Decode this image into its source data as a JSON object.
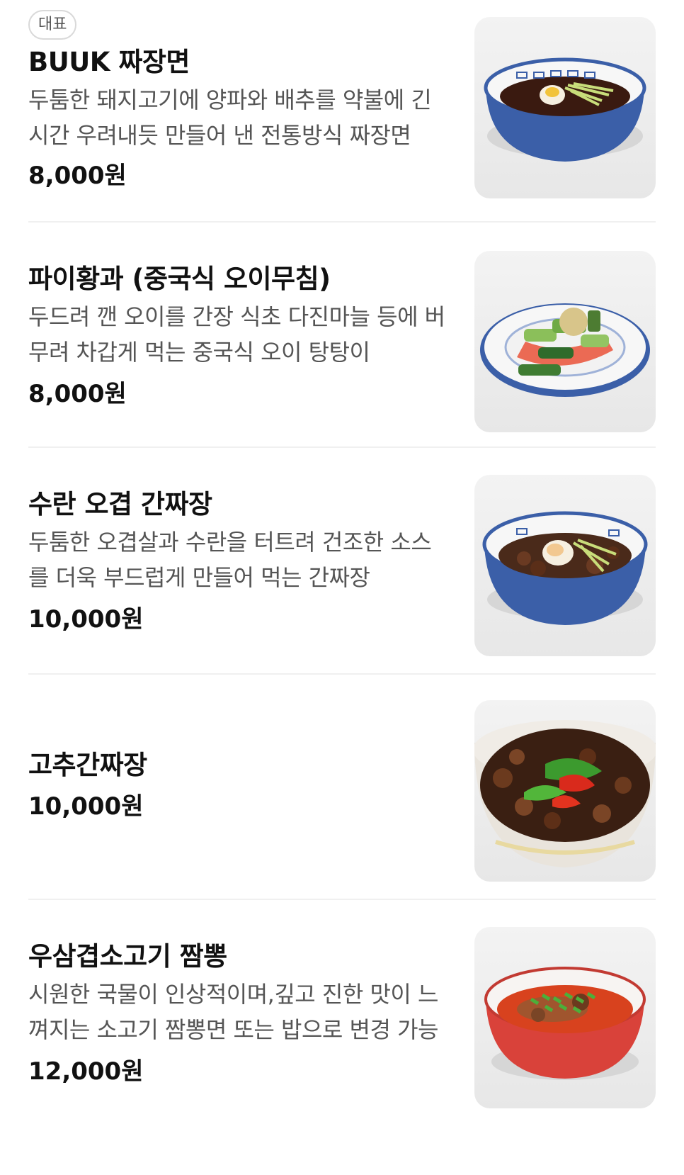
{
  "menu": {
    "items": [
      {
        "badge": "대표",
        "name": "BUUK 짜장면",
        "description": "두툼한 돼지고기에 양파와 배추를 약불에 긴 시간 우려내듯 만들어 낸 전통방식 짜장면",
        "price": "8,000원",
        "image_icon": "jajangmyeon-bowl-photo"
      },
      {
        "name": "파이황과 (중국식 오이무침)",
        "description": "두드려 깬 오이를 간장 식초 다진마늘 등에 버무려 차갑게 먹는 중국식 오이 탕탕이",
        "price": "8,000원",
        "image_icon": "cucumber-salad-plate-photo"
      },
      {
        "name": "수란 오겹 간짜장",
        "description": "두툼한 오겹살과 수란을 터트려 건조한 소스를 더욱 부드럽게 만들어 먹는 간짜장",
        "price": "10,000원",
        "image_icon": "ganjjajang-bowl-photo"
      },
      {
        "name": "고추간짜장",
        "price": "10,000원",
        "image_icon": "pepper-ganjjajang-bowl-photo"
      },
      {
        "name": "우삼겹소고기 짬뽕",
        "description": "시원한 국물이 인상적이며,깊고 진한 맛이 느껴지는 소고기 짬뽕면 또는 밥으로 변경 가능",
        "price": "12,000원",
        "image_icon": "jjamppong-bowl-photo"
      }
    ]
  }
}
